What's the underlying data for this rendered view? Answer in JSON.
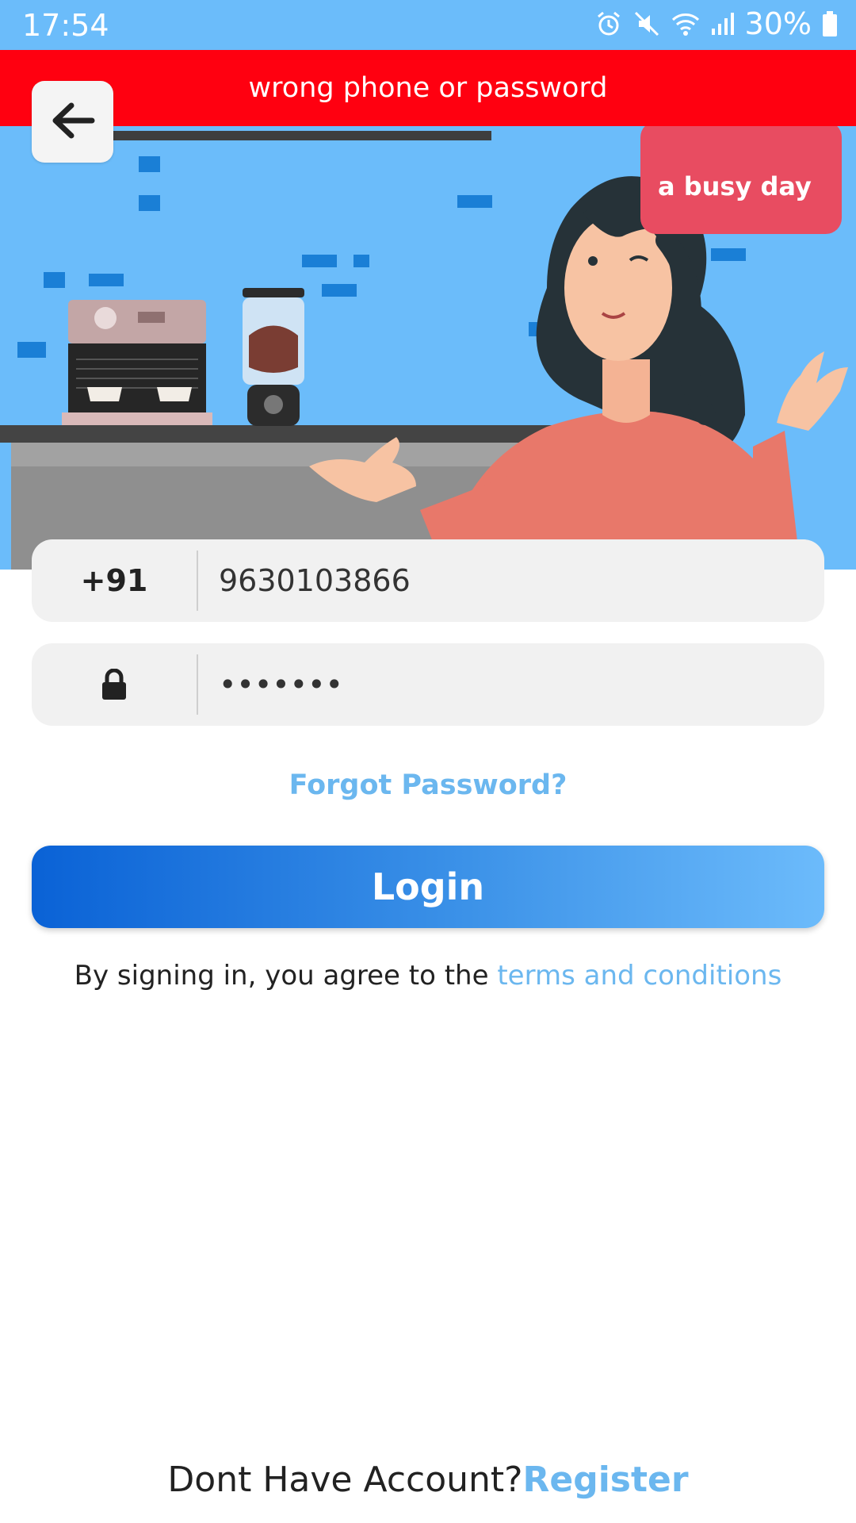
{
  "status_bar": {
    "time": "17:54",
    "battery": "30%"
  },
  "error_banner": {
    "text": "wrong phone or password"
  },
  "hero": {
    "bubble_text": "a busy day"
  },
  "phone_field": {
    "country_code": "+91",
    "value": "9630103866"
  },
  "password_field": {
    "value": "•••••••"
  },
  "forgot_password": "Forgot Password?",
  "login_button": "Login",
  "terms": {
    "prefix": "By signing in, you agree to the ",
    "link": "terms and conditions"
  },
  "register": {
    "prompt": "Dont Have Account?",
    "link": "Register"
  },
  "colors": {
    "accent": "#6bb7ef",
    "error": "#ff0010",
    "hero_bg": "#6bbcfa",
    "button_start": "#0a62d6",
    "button_end": "#6cbbfb"
  }
}
